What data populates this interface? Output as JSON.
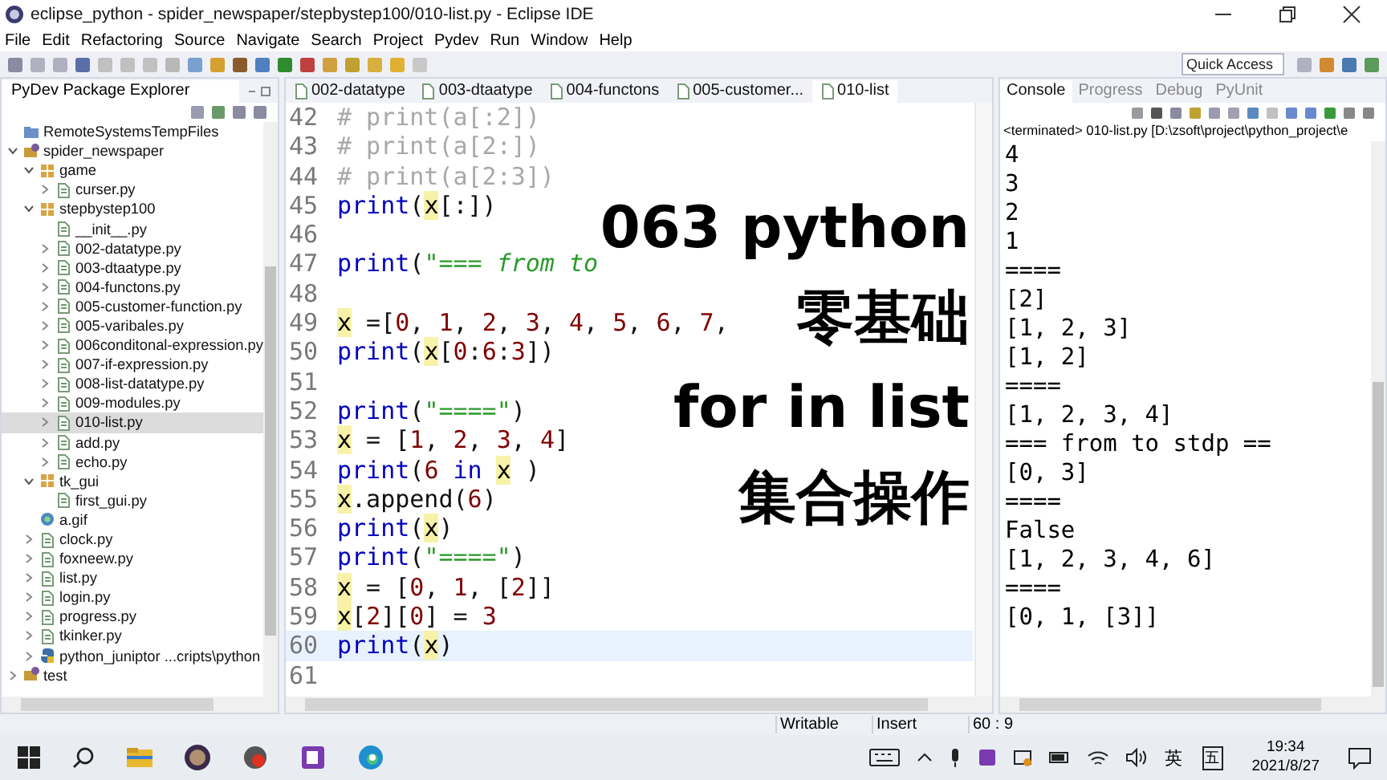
{
  "window": {
    "title": "eclipse_python - spider_newspaper/stepbystep100/010-list.py - Eclipse IDE"
  },
  "menu": [
    "File",
    "Edit",
    "Refactoring",
    "Source",
    "Navigate",
    "Search",
    "Project",
    "Pydev",
    "Run",
    "Window",
    "Help"
  ],
  "toolbar": {
    "quick_access": {
      "placeholder": "Quick Access"
    }
  },
  "explorer": {
    "title": "PyDev Package Explorer",
    "items": [
      {
        "label": "RemoteSystemsTempFiles",
        "kind": "folder",
        "selected": false
      },
      {
        "label": "spider_newspaper",
        "kind": "project",
        "expanded": true,
        "selected": false,
        "children": [
          {
            "label": "game",
            "kind": "package",
            "expanded": true,
            "selected": false,
            "children": [
              {
                "label": "curser.py",
                "kind": "file",
                "expanded": false,
                "selected": false
              }
            ]
          },
          {
            "label": "stepbystep100",
            "kind": "package",
            "expanded": true,
            "selected": false,
            "children": [
              {
                "label": "__init__.py",
                "kind": "file",
                "selected": false
              },
              {
                "label": "002-datatype.py",
                "kind": "file",
                "expanded": false,
                "selected": false
              },
              {
                "label": "003-dtaatype.py",
                "kind": "file",
                "expanded": false,
                "selected": false
              },
              {
                "label": "004-functons.py",
                "kind": "file",
                "expanded": false,
                "selected": false
              },
              {
                "label": "005-customer-function.py",
                "kind": "file",
                "expanded": false,
                "selected": false
              },
              {
                "label": "005-varibales.py",
                "kind": "file",
                "expanded": false,
                "selected": false
              },
              {
                "label": "006conditonal-expression.py",
                "kind": "file",
                "expanded": false,
                "selected": false
              },
              {
                "label": "007-if-expression.py",
                "kind": "file",
                "expanded": false,
                "selected": false
              },
              {
                "label": "008-list-datatype.py",
                "kind": "file",
                "expanded": false,
                "selected": false
              },
              {
                "label": "009-modules.py",
                "kind": "file",
                "expanded": false,
                "selected": false
              },
              {
                "label": "010-list.py",
                "kind": "file",
                "expanded": false,
                "selected": true
              },
              {
                "label": "add.py",
                "kind": "file",
                "expanded": false,
                "selected": false
              },
              {
                "label": "echo.py",
                "kind": "file",
                "expanded": false,
                "selected": false
              }
            ]
          },
          {
            "label": "tk_gui",
            "kind": "package",
            "expanded": true,
            "selected": false,
            "children": [
              {
                "label": "first_gui.py",
                "kind": "file",
                "selected": false
              }
            ]
          },
          {
            "label": "a.gif",
            "kind": "image",
            "selected": false
          },
          {
            "label": "clock.py",
            "kind": "file",
            "expanded": false,
            "selected": false
          },
          {
            "label": "foxneew.py",
            "kind": "file",
            "expanded": false,
            "selected": false
          },
          {
            "label": "list.py",
            "kind": "file",
            "expanded": false,
            "selected": false
          },
          {
            "label": "login.py",
            "kind": "file",
            "expanded": false,
            "selected": false
          },
          {
            "label": "progress.py",
            "kind": "file",
            "expanded": false,
            "selected": false
          },
          {
            "label": "tkinker.py",
            "kind": "file",
            "expanded": false,
            "selected": false
          },
          {
            "label": "python_juniptor    ...cripts\\python",
            "kind": "python",
            "expanded": false,
            "selected": false
          }
        ]
      },
      {
        "label": "test",
        "kind": "project",
        "expanded": false,
        "selected": false
      }
    ]
  },
  "editor": {
    "tabs": [
      {
        "label": "002-datatype",
        "selected": false
      },
      {
        "label": "003-dtaatype",
        "selected": false
      },
      {
        "label": "004-functons",
        "selected": false
      },
      {
        "label": "005-customer...",
        "selected": false
      },
      {
        "label": "010-list",
        "selected": true
      }
    ],
    "lines": [
      {
        "number": "42",
        "current": false,
        "tokens": [
          {
            "kind": "comment",
            "text": "# print(a[:2])"
          }
        ]
      },
      {
        "number": "43",
        "current": false,
        "tokens": [
          {
            "kind": "comment",
            "text": "# print(a[2:])"
          }
        ]
      },
      {
        "number": "44",
        "current": false,
        "tokens": [
          {
            "kind": "comment",
            "text": "# print(a[2:3])"
          }
        ]
      },
      {
        "number": "45",
        "current": false,
        "tokens": [
          {
            "kind": "keyword",
            "text": "print"
          },
          {
            "kind": "plain",
            "text": "("
          },
          {
            "kind": "var",
            "text": "x"
          },
          {
            "kind": "plain",
            "text": "[:])"
          }
        ]
      },
      {
        "number": "46",
        "current": false
      },
      {
        "number": "47",
        "current": false,
        "tokens": [
          {
            "kind": "keyword",
            "text": "print"
          },
          {
            "kind": "plain",
            "text": "("
          },
          {
            "kind": "string",
            "text": "\"=== from to"
          }
        ]
      },
      {
        "number": "48",
        "current": false
      },
      {
        "number": "49",
        "current": false,
        "tokens": [
          {
            "kind": "var",
            "text": "x"
          },
          {
            "kind": "plain",
            "text": " =["
          },
          {
            "kind": "number",
            "text": "0"
          },
          {
            "kind": "plain",
            "text": ", "
          },
          {
            "kind": "number",
            "text": "1"
          },
          {
            "kind": "plain",
            "text": ", "
          },
          {
            "kind": "number",
            "text": "2"
          },
          {
            "kind": "plain",
            "text": ", "
          },
          {
            "kind": "number",
            "text": "3"
          },
          {
            "kind": "plain",
            "text": ", "
          },
          {
            "kind": "number",
            "text": "4"
          },
          {
            "kind": "plain",
            "text": ", "
          },
          {
            "kind": "number",
            "text": "5"
          },
          {
            "kind": "plain",
            "text": ", "
          },
          {
            "kind": "number",
            "text": "6"
          },
          {
            "kind": "plain",
            "text": ", "
          },
          {
            "kind": "number",
            "text": "7"
          },
          {
            "kind": "plain",
            "text": ","
          }
        ]
      },
      {
        "number": "50",
        "current": false,
        "tokens": [
          {
            "kind": "keyword",
            "text": "print"
          },
          {
            "kind": "plain",
            "text": "("
          },
          {
            "kind": "var",
            "text": "x"
          },
          {
            "kind": "plain",
            "text": "["
          },
          {
            "kind": "number",
            "text": "0"
          },
          {
            "kind": "plain",
            "text": ":"
          },
          {
            "kind": "number",
            "text": "6"
          },
          {
            "kind": "plain",
            "text": ":"
          },
          {
            "kind": "number",
            "text": "3"
          },
          {
            "kind": "plain",
            "text": "])"
          }
        ]
      },
      {
        "number": "51",
        "current": false
      },
      {
        "number": "52",
        "current": false,
        "tokens": [
          {
            "kind": "keyword",
            "text": "print"
          },
          {
            "kind": "plain",
            "text": "("
          },
          {
            "kind": "string",
            "text": "\"====\""
          },
          {
            "kind": "plain",
            "text": ")"
          }
        ]
      },
      {
        "number": "53",
        "current": false,
        "tokens": [
          {
            "kind": "var",
            "text": "x"
          },
          {
            "kind": "plain",
            "text": " = ["
          },
          {
            "kind": "number",
            "text": "1"
          },
          {
            "kind": "plain",
            "text": ", "
          },
          {
            "kind": "number",
            "text": "2"
          },
          {
            "kind": "plain",
            "text": ", "
          },
          {
            "kind": "number",
            "text": "3"
          },
          {
            "kind": "plain",
            "text": ", "
          },
          {
            "kind": "number",
            "text": "4"
          },
          {
            "kind": "plain",
            "text": "]"
          }
        ]
      },
      {
        "number": "54",
        "current": false,
        "tokens": [
          {
            "kind": "keyword",
            "text": "print"
          },
          {
            "kind": "plain",
            "text": "("
          },
          {
            "kind": "number",
            "text": "6"
          },
          {
            "kind": "keyword",
            "text": " in "
          },
          {
            "kind": "var",
            "text": "x"
          },
          {
            "kind": "plain",
            "text": " )"
          }
        ]
      },
      {
        "number": "55",
        "current": false,
        "tokens": [
          {
            "kind": "var",
            "text": "x"
          },
          {
            "kind": "plain",
            "text": ".append("
          },
          {
            "kind": "number",
            "text": "6"
          },
          {
            "kind": "plain",
            "text": ")"
          }
        ]
      },
      {
        "number": "56",
        "current": false,
        "tokens": [
          {
            "kind": "keyword",
            "text": "print"
          },
          {
            "kind": "plain",
            "text": "("
          },
          {
            "kind": "var",
            "text": "x"
          },
          {
            "kind": "plain",
            "text": ")"
          }
        ]
      },
      {
        "number": "57",
        "current": false,
        "tokens": [
          {
            "kind": "keyword",
            "text": "print"
          },
          {
            "kind": "plain",
            "text": "("
          },
          {
            "kind": "string",
            "text": "\"====\""
          },
          {
            "kind": "plain",
            "text": ")"
          }
        ]
      },
      {
        "number": "58",
        "current": false,
        "tokens": [
          {
            "kind": "var",
            "text": "x"
          },
          {
            "kind": "plain",
            "text": " = ["
          },
          {
            "kind": "number",
            "text": "0"
          },
          {
            "kind": "plain",
            "text": ", "
          },
          {
            "kind": "number",
            "text": "1"
          },
          {
            "kind": "plain",
            "text": ", ["
          },
          {
            "kind": "number",
            "text": "2"
          },
          {
            "kind": "plain",
            "text": "]]"
          }
        ]
      },
      {
        "number": "59",
        "current": false,
        "tokens": [
          {
            "kind": "var",
            "text": "x"
          },
          {
            "kind": "plain",
            "text": "["
          },
          {
            "kind": "number",
            "text": "2"
          },
          {
            "kind": "plain",
            "text": "]["
          },
          {
            "kind": "number",
            "text": "0"
          },
          {
            "kind": "plain",
            "text": "] = "
          },
          {
            "kind": "number",
            "text": "3"
          }
        ]
      },
      {
        "number": "60",
        "current": true,
        "tokens": [
          {
            "kind": "keyword",
            "text": "print"
          },
          {
            "kind": "plain",
            "text": "("
          },
          {
            "kind": "var",
            "text": "x"
          },
          {
            "kind": "plain",
            "text": ")"
          }
        ]
      },
      {
        "number": "61",
        "current": false
      }
    ]
  },
  "overlay": {
    "lines": [
      "063 python",
      "零基础",
      "for in list",
      "集合操作"
    ]
  },
  "console": {
    "tabs": [
      {
        "label": "Console",
        "selected": true
      },
      {
        "label": "Progress",
        "selected": false
      },
      {
        "label": "Debug",
        "selected": false
      },
      {
        "label": "PyUnit",
        "selected": false
      }
    ],
    "status": "<terminated> 010-list.py [D:\\zsoft\\project\\python_project\\e",
    "lines": [
      "4",
      "3",
      "2",
      "1",
      "====",
      "[2]",
      "[1, 2, 3]",
      "[1, 2]",
      "====",
      "[1, 2, 3, 4]",
      "=== from to stdp ==",
      "[0, 3]",
      "====",
      "False",
      "[1, 2, 3, 4, 6]",
      "====",
      "[0, 1, [3]]"
    ]
  },
  "status_bar": [
    "Writable",
    "Insert",
    "60 : 9"
  ],
  "taskbar": {
    "ime": "英",
    "ime_mode": "五",
    "time": "19:34",
    "date": "2021/8/27"
  }
}
